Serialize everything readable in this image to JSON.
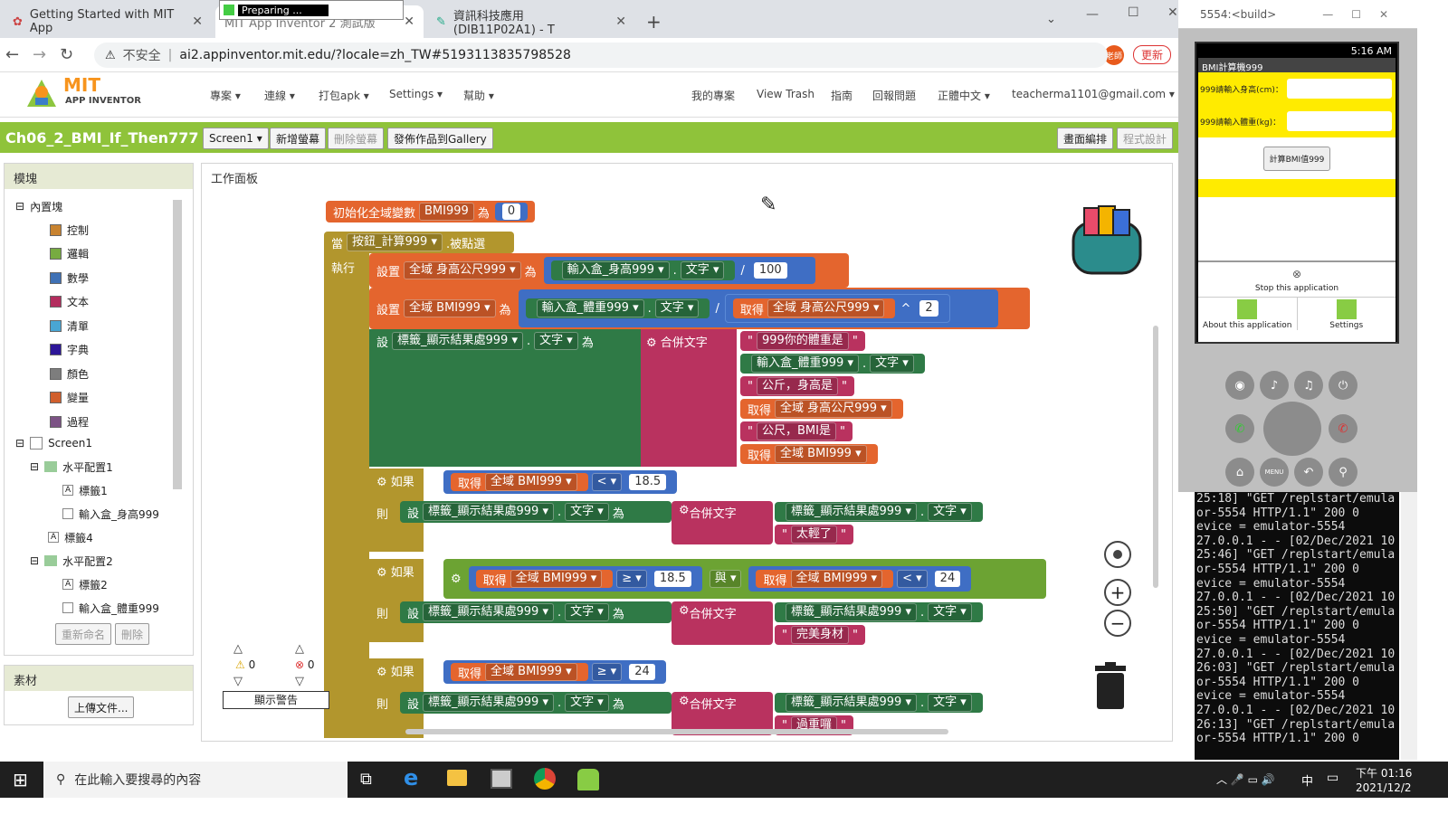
{
  "browser": {
    "tabs": [
      {
        "title": "Getting Started with MIT App"
      },
      {
        "title": "MIT App Inventor 2 測試版"
      },
      {
        "title": "資訊科技應用 (DIB11P02A1) - T"
      }
    ],
    "preparing_label": "Preparing ...",
    "insecure_label": "不安全",
    "url": "ai2.appinventor.mit.edu/?locale=zh_TW#5193113835798528",
    "update_label": "更新",
    "avatar_label": "老師"
  },
  "app": {
    "logo_mit": "MIT",
    "logo_sub": "APP INVENTOR",
    "menus": [
      "專案",
      "連線",
      "打包apk",
      "Settings",
      "幫助"
    ],
    "right_menus": [
      "我的專案",
      "View Trash",
      "指南",
      "回報問題",
      "正體中文"
    ],
    "account": "teacherma1101@gmail.com",
    "project_name": "Ch06_2_BMI_If_Then777",
    "screen_dropdown": "Screen1",
    "add_screen": "新增螢幕",
    "remove_screen": "刪除螢幕",
    "publish": "發佈作品到Gallery",
    "designer": "畫面編排",
    "blocks_editor": "程式設計"
  },
  "blocks_panel": {
    "title": "模塊",
    "builtin": "內置塊",
    "categories": [
      {
        "label": "控制",
        "color": "#c88330"
      },
      {
        "label": "邏輯",
        "color": "#77ab41"
      },
      {
        "label": "數學",
        "color": "#3f71b5"
      },
      {
        "label": "文本",
        "color": "#b32d5e"
      },
      {
        "label": "清單",
        "color": "#49a6d4"
      },
      {
        "label": "字典",
        "color": "#2d1799"
      },
      {
        "label": "顏色",
        "color": "#7d7d7d"
      },
      {
        "label": "變量",
        "color": "#d05f2d"
      },
      {
        "label": "過程",
        "color": "#7c5385"
      }
    ],
    "components": [
      "Screen1",
      "水平配置1",
      "標籤1",
      "輸入盒_身高999",
      "標籤4",
      "水平配置2",
      "標籤2",
      "輸入盒_體重999"
    ],
    "rename": "重新命名",
    "delete": "刪除"
  },
  "media_panel": {
    "title": "素材",
    "upload": "上傳文件..."
  },
  "viewer": {
    "title": "工作面板",
    "warnings": "0",
    "errors": "0",
    "show_warnings": "顯示警告"
  },
  "blocks": {
    "init_global": "初始化全域變數",
    "var_bmi": "BMI999",
    "as": "為",
    "zero": "0",
    "when": "當",
    "button": "按鈕_計算999",
    "clicked": ".被點選",
    "do": "執行",
    "set": "設置",
    "global_height": "全域 身高公尺999",
    "global_bmi": "全域 BMI999",
    "txt_height": "輸入盒_身高999",
    "txt_weight": "輸入盒_體重999",
    "text_prop": "文字",
    "div": "/",
    "hundred": "100",
    "get": "取得",
    "pow": "^",
    "two": "2",
    "set_short": "設",
    "label_result": "標籤_顯示結果處999",
    "join": "合併文字",
    "str1": "999你的體重是",
    "str2": "公斤，身高是",
    "str3": "公尺，BMI是",
    "if": "如果",
    "then": "則",
    "lt": "<",
    "ge": "≥",
    "v185": "18.5",
    "v24": "24",
    "and": "與",
    "thin": "太輕了",
    "perfect": "完美身材",
    "heavy": "過重囉"
  },
  "emulator": {
    "window_title": "5554:<build>",
    "time": "5:16",
    "ampm": "AM",
    "app_title": "BMI計算機999",
    "height_label": "999請輸入身高(cm)：",
    "weight_label": "999請輸入體重(kg)：",
    "calc_button": "計算BMI值999",
    "stop_label": "Stop this application",
    "about_label": "About this application",
    "settings_label": "Settings",
    "menu_key": "MENU"
  },
  "console_lines": [
    "25:18] \"GET /replstart/emula",
    "or-5554 HTTP/1.1\" 200 0",
    "evice = emulator-5554",
    "27.0.0.1 - - [02/Dec/2021 10",
    "25:46] \"GET /replstart/emula",
    "or-5554 HTTP/1.1\" 200 0",
    "evice = emulator-5554",
    "27.0.0.1 - - [02/Dec/2021 10",
    "25:50] \"GET /replstart/emula",
    "or-5554 HTTP/1.1\" 200 0",
    "evice = emulator-5554",
    "27.0.0.1 - - [02/Dec/2021 10",
    "26:03] \"GET /replstart/emula",
    "or-5554 HTTP/1.1\" 200 0",
    "evice = emulator-5554",
    "27.0.0.1 - - [02/Dec/2021 10",
    "26:13] \"GET /replstart/emula",
    "or-5554 HTTP/1.1\" 200 0"
  ],
  "taskbar": {
    "search_placeholder": "在此輸入要搜尋的內容",
    "time": "下午 01:16",
    "date": "2021/12/2",
    "ime": "中"
  }
}
